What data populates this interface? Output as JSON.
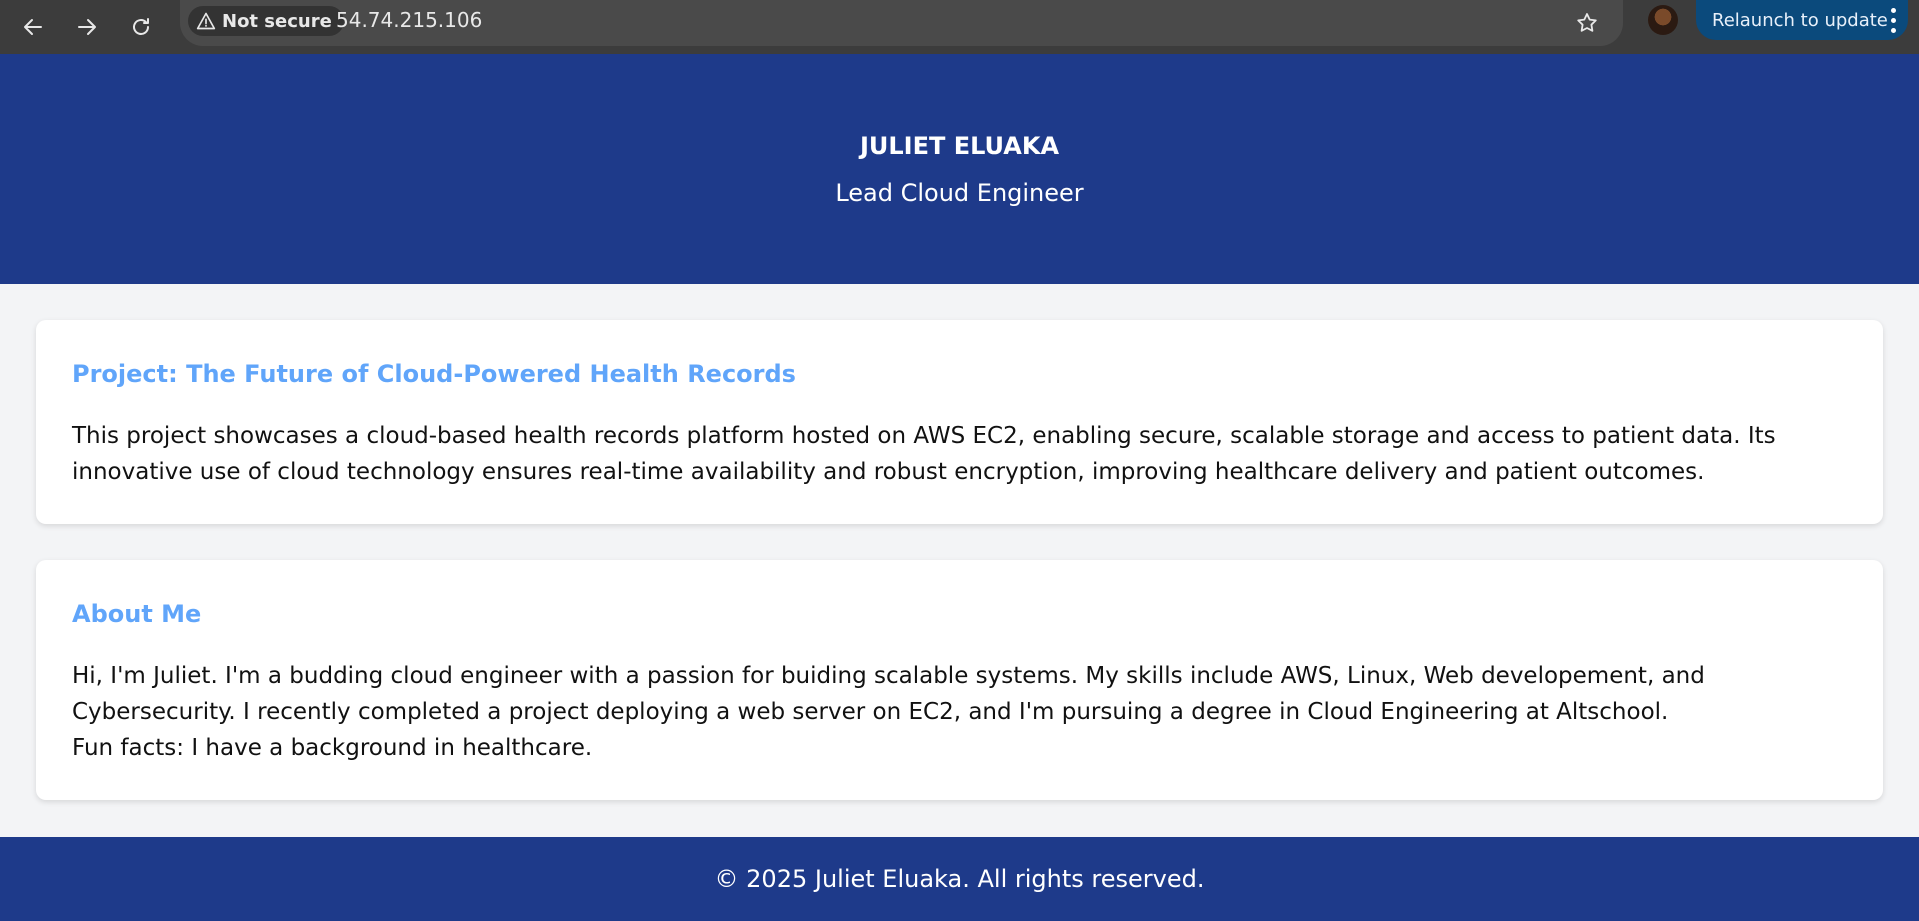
{
  "browser": {
    "security_label": "Not secure",
    "url": "54.74.215.106",
    "relaunch_label": "Relaunch to update"
  },
  "header": {
    "name": "JULIET ELUAKA",
    "role": "Lead Cloud Engineer"
  },
  "project": {
    "title": "Project: The Future of Cloud-Powered Health Records",
    "body": "This project showcases a cloud-based health records platform hosted on AWS EC2, enabling secure, scalable storage and access to patient data. Its innovative use of cloud technology ensures real-time availability and robust encryption, improving healthcare delivery and patient outcomes."
  },
  "about": {
    "title": "About Me",
    "body": "Hi, I'm Juliet. I'm a budding cloud engineer with a passion for buiding scalable systems. My skills include AWS, Linux, Web developement, and Cybersecurity. I recently completed a project deploying a web server on EC2, and I'm pursuing a degree in Cloud Engineering at Altschool.",
    "fun_facts": "Fun facts: I have a background in healthcare."
  },
  "footer": {
    "copyright": "© 2025 Juliet Eluaka. All rights reserved."
  }
}
